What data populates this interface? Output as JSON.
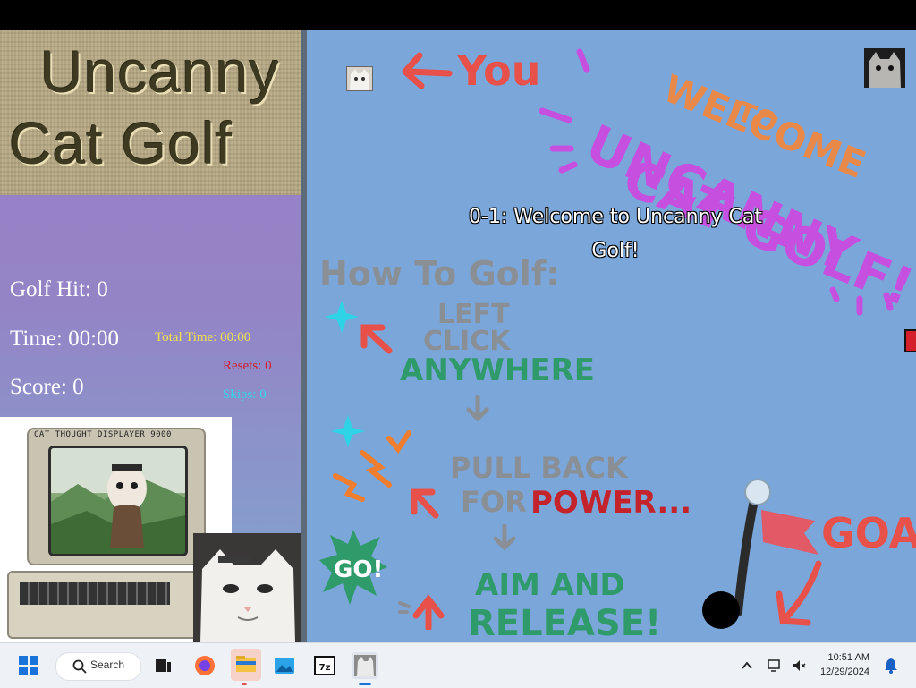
{
  "sidebar": {
    "logo_line1": "Uncanny",
    "logo_line2": "Cat Golf",
    "golf_hit": "Golf Hit: 0",
    "time": "Time: 00:00",
    "score": "Score: 0",
    "total_time": "Total Time: 00:00",
    "resets": "Resets: 0",
    "skips": "Skips: 0",
    "computer_label": "CAT THOUGHT DISPLAYER 9000"
  },
  "game": {
    "level_title": "0-1: Welcome to Uncanny Cat Golf!",
    "you_label": "You",
    "welcome_line1": "WELCOME",
    "welcome_line2": "TO",
    "welcome_line3": "UNCANNY",
    "welcome_line4": "CAT GOLF!",
    "how_to": "How To Golf:",
    "step1a": "LEFT",
    "step1b": "CLICK",
    "step1c": "ANYWHERE",
    "step2a": "PULL BACK",
    "step2b": "FOR",
    "step2c": "POWER...",
    "step3a": "AIM AND",
    "step3b": "RELEASE!",
    "go_label": "GO!",
    "goal_label": "GOAL"
  },
  "taskbar": {
    "search_label": "Search",
    "time": "10:51 AM",
    "date": "12/29/2024"
  },
  "colors": {
    "game_bg": "#7aa6d9",
    "welcome_orange": "#e8894a",
    "welcome_purple": "#c64fe0",
    "you_red": "#e8504a",
    "howto_gray": "#8a8f96",
    "anywhere_green": "#2f9a6a",
    "power_red": "#c4232b",
    "flag_red": "#e8504a"
  }
}
